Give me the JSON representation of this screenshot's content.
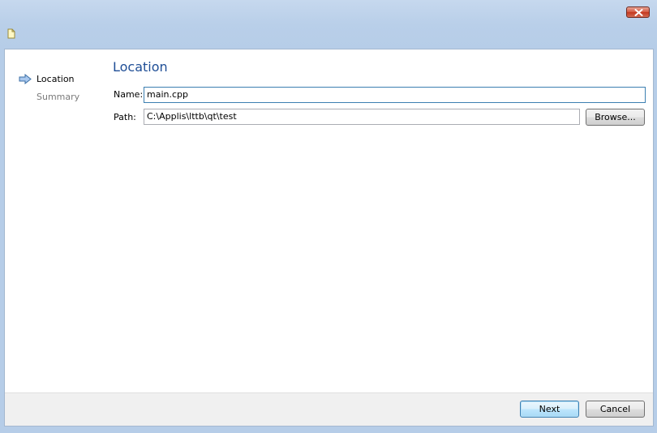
{
  "window": {
    "close_icon": "close-icon",
    "app_icon": "document-icon"
  },
  "wizard": {
    "steps": [
      {
        "label": "Location",
        "active": true
      },
      {
        "label": "Summary",
        "active": false
      }
    ],
    "page_title": "Location",
    "fields": {
      "name_label": "Name:",
      "name_value": "main.cpp",
      "path_label": "Path:",
      "path_value": "C:\\Applis\\lttb\\qt\\test"
    },
    "browse_label": "Browse...",
    "buttons": {
      "next_label": "Next",
      "cancel_label": "Cancel"
    }
  },
  "colors": {
    "title_color": "#1f4e96",
    "active_step": "#000000",
    "inactive_step": "#7a7a7a"
  }
}
